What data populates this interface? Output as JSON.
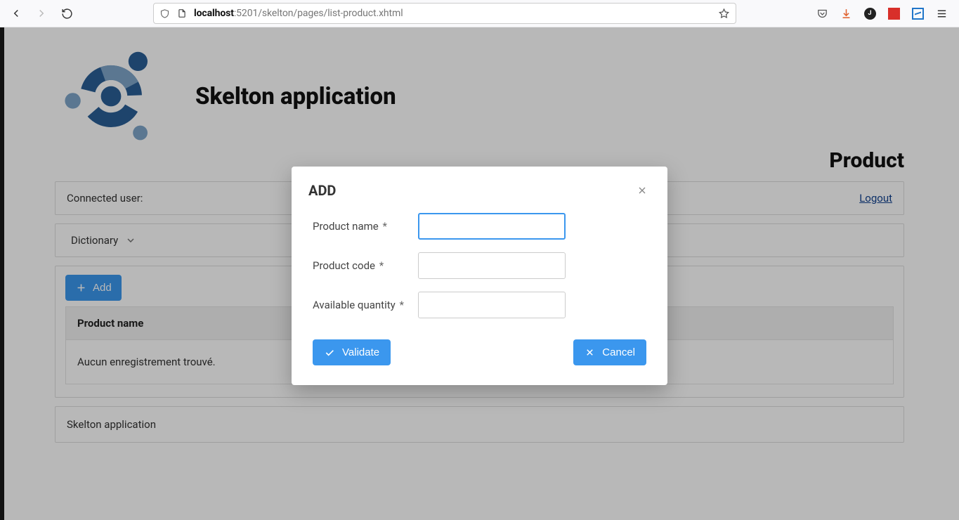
{
  "browser": {
    "url_host": "localhost",
    "url_rest": ":5201/skelton/pages/list-product.xhtml",
    "avatar_letter": "J"
  },
  "header": {
    "app_title": "Skelton application",
    "page_heading": "Product"
  },
  "userbar": {
    "connected_label": "Connected user:",
    "logout": "Logout"
  },
  "menu": {
    "dictionary": "Dictionary"
  },
  "toolbar": {
    "add_label": "Add"
  },
  "table": {
    "col_product_name": "Product name",
    "empty": "Aucun enregistrement trouvé."
  },
  "footer": {
    "text": "Skelton application"
  },
  "modal": {
    "title": "ADD",
    "fields": {
      "product_name": {
        "label": "Product name",
        "required": "*",
        "value": ""
      },
      "product_code": {
        "label": "Product code",
        "required": "*",
        "value": ""
      },
      "available_qty": {
        "label": "Available quantity",
        "required": "*",
        "value": ""
      }
    },
    "buttons": {
      "validate": "Validate",
      "cancel": "Cancel"
    }
  },
  "colors": {
    "primary": "#3b97ee",
    "logo_dark": "#2a5f96",
    "logo_light": "#7fa6c9"
  }
}
